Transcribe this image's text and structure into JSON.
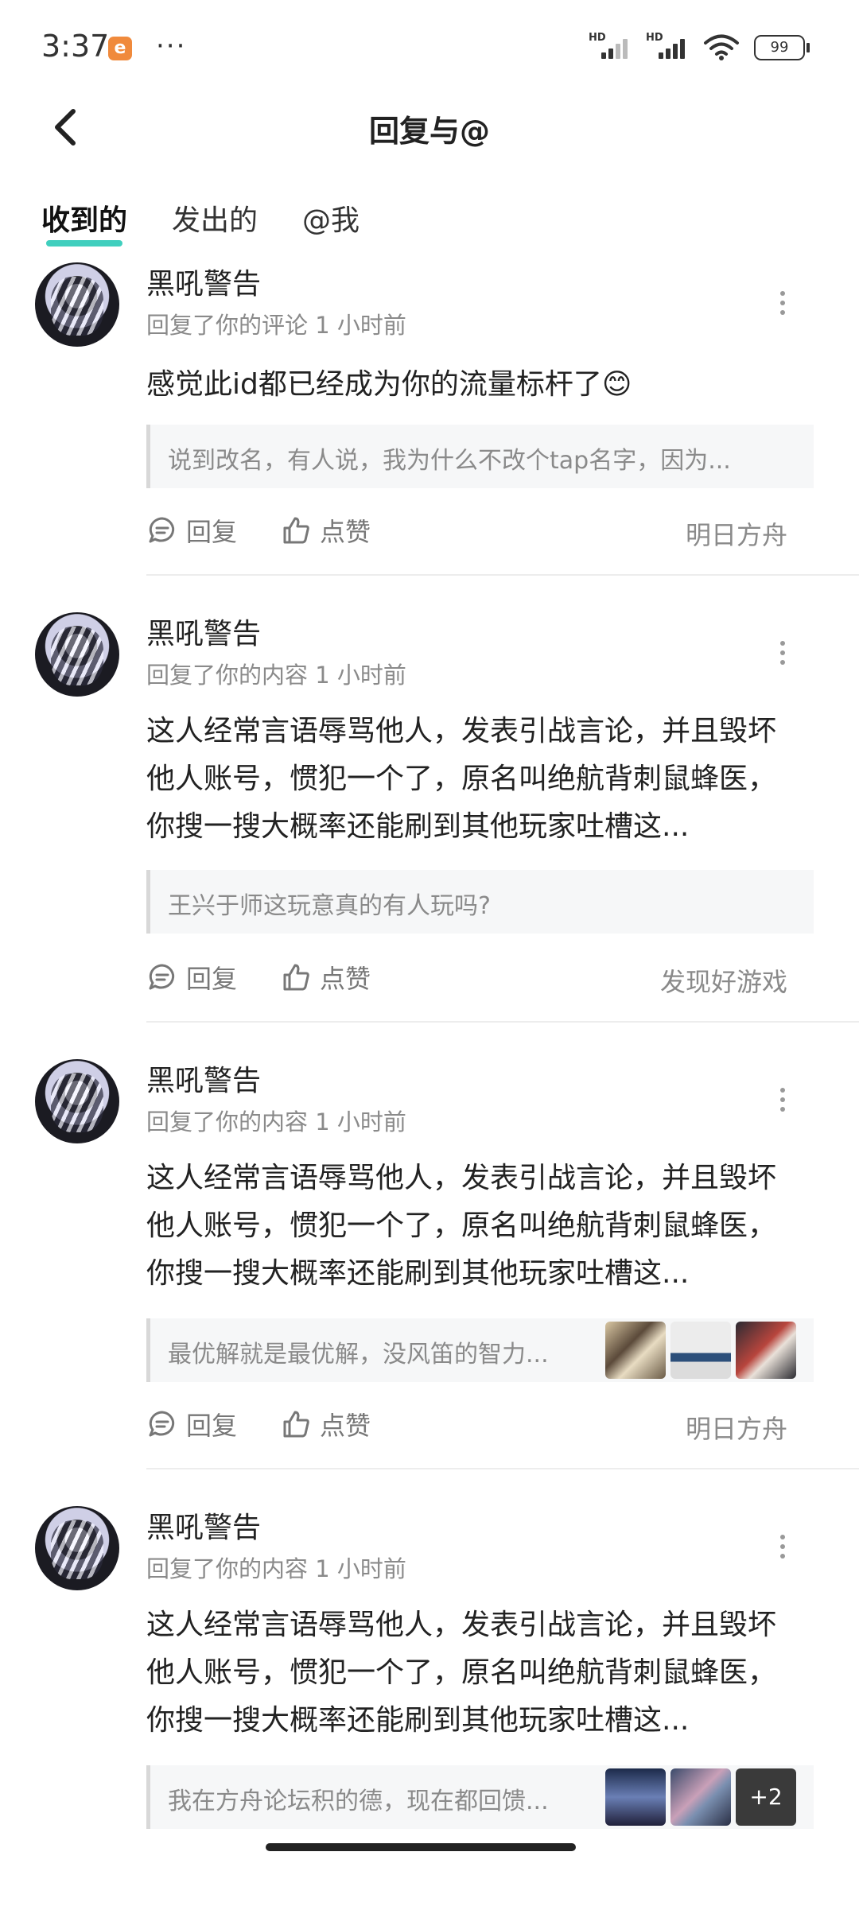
{
  "status_bar": {
    "time": "3:37",
    "app_badge": "e",
    "dots": "···",
    "signal1_label": "HD",
    "signal2_label": "HD",
    "battery": "99"
  },
  "header": {
    "title": "回复与@"
  },
  "tabs": [
    {
      "label": "收到的",
      "active": true
    },
    {
      "label": "发出的",
      "active": false
    },
    {
      "label": "@我",
      "active": false
    }
  ],
  "items": [
    {
      "username": "黑吼警告",
      "meta": "回复了你的评论 1 小时前",
      "content": "感觉此id都已经成为你的流量标杆了😊",
      "quote": "说到改名，有人说，我为什么不改个tap名字，因为...",
      "reply_label": "回复",
      "like_label": "点赞",
      "tag": "明日方舟"
    },
    {
      "username": "黑吼警告",
      "meta": "回复了你的内容 1 小时前",
      "content": "这人经常言语辱骂他人，发表引战言论，并且毁坏他人账号，惯犯一个了，原名叫绝航背刺鼠蜂医，你搜一搜大概率还能刷到其他玩家吐槽这...",
      "quote": "王兴于师这玩意真的有人玩吗?",
      "reply_label": "回复",
      "like_label": "点赞",
      "tag": "发现好游戏"
    },
    {
      "username": "黑吼警告",
      "meta": "回复了你的内容 1 小时前",
      "content": "这人经常言语辱骂他人，发表引战言论，并且毁坏他人账号，惯犯一个了，原名叫绝航背刺鼠蜂医，你搜一搜大概率还能刷到其他玩家吐槽这...",
      "quote": "最优解就是最优解，没风笛的智力...",
      "reply_label": "回复",
      "like_label": "点赞",
      "tag": "明日方舟"
    },
    {
      "username": "黑吼警告",
      "meta": "回复了你的内容 1 小时前",
      "content": "这人经常言语辱骂他人，发表引战言论，并且毁坏他人账号，惯犯一个了，原名叫绝航背刺鼠蜂医，你搜一搜大概率还能刷到其他玩家吐槽这...",
      "quote": "我在方舟论坛积的德，现在都回馈...",
      "more_images": "+2"
    }
  ],
  "colors": {
    "accent_underline": "#1fc7b3",
    "text_secondary": "#8a8a8a"
  },
  "icons": [
    "back-arrow-icon",
    "more-vertical-icon",
    "comment-icon",
    "thumbs-up-icon",
    "wifi-icon",
    "battery-icon"
  ]
}
